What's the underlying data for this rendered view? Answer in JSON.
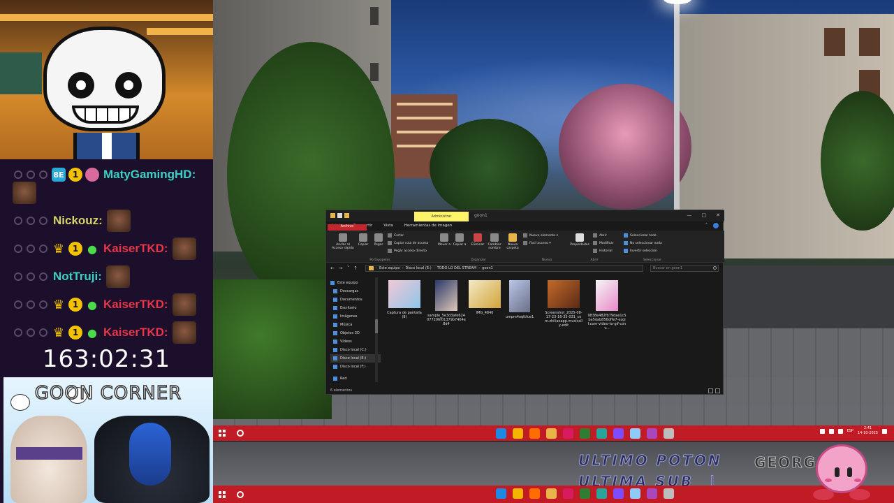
{
  "chat": {
    "messages": [
      {
        "user": "MatyGamingHD:",
        "color": "#3fd0c4",
        "badges": [
          "sq",
          "one",
          "pepe"
        ]
      },
      {
        "user": "Nickouz:",
        "color": "#d6d26a",
        "badges": []
      },
      {
        "user": "KaiserTKD:",
        "color": "#e8354a",
        "badges": [
          "crown",
          "one",
          "frog"
        ]
      },
      {
        "user": "NotTruji:",
        "color": "#3fd0c4",
        "badges": []
      },
      {
        "user": "KaiserTKD:",
        "color": "#e8354a",
        "badges": [
          "crown",
          "one",
          "frog"
        ]
      },
      {
        "user": "KaiserTKD:",
        "color": "#e8354a",
        "badges": [
          "crown",
          "one",
          "frog"
        ]
      }
    ],
    "badge_one_label": "1",
    "badge_sq_label": "8E"
  },
  "timer": "163:02:31",
  "goon_corner": {
    "title": "GOON CORNER"
  },
  "explorer": {
    "window_title": "goon1",
    "context_tab": "Administrar",
    "tabs": [
      "Archivo",
      "Inicio",
      "Compartir",
      "Vista",
      "Herramientas de imagen"
    ],
    "ribbon": {
      "pin": "Anclar al Acceso rápido",
      "copy": "Copiar",
      "paste": "Pegar",
      "cut": "Cortar",
      "copy_path": "Copiar ruta de acceso",
      "paste_shortcut": "Pegar acceso directo",
      "move_to": "Mover a",
      "copy_to": "Copiar a",
      "delete": "Eliminar",
      "rename": "Cambiar nombre",
      "new_folder": "Nueva carpeta",
      "new_item": "Nuevo elemento ▾",
      "easy_access": "Fácil acceso ▾",
      "properties": "Propiedades",
      "open": "Abrir",
      "edit": "Modificar",
      "history": "Historial",
      "select_all": "Seleccionar todo",
      "select_none": "No seleccionar nada",
      "invert_selection": "Invertir selección",
      "group_clipboard": "Portapapeles",
      "group_organize": "Organizar",
      "group_new": "Nuevo",
      "group_open": "Abrir",
      "group_select": "Seleccionar"
    },
    "address": [
      "Este equipo",
      "Disco local (E:)",
      "TODO LO DEL STREAM",
      "goon1"
    ],
    "search_placeholder": "Buscar en goon1",
    "nav_items": [
      "Este equipo",
      "Descargas",
      "Documentos",
      "Escritorio",
      "Imágenes",
      "Música",
      "Objetos 3D",
      "Vídeos",
      "Disco local (C:)",
      "Disco local (E:)",
      "Disco local (F:)",
      "Red"
    ],
    "files": [
      {
        "name": "Captura de pantalla (8)",
        "colors": [
          "#f2c8d6",
          "#8fc5ea"
        ]
      },
      {
        "name": "sample_5e3d3afe624077206f01379b7464e8d4",
        "colors": [
          "#2a3a6a",
          "#e0c8b8"
        ]
      },
      {
        "name": "IMG_4840",
        "colors": [
          "#f3e9c6",
          "#d2a43a"
        ]
      },
      {
        "name": "umpm4oqttfue1",
        "colors": [
          "#b8c7e8",
          "#6a6f86"
        ]
      },
      {
        "name": "Screenshot_2025-08-17-23-16-35-031_com.zhiliaoapp.musically-edit",
        "colors": [
          "#c46a2a",
          "#5a2a16"
        ]
      },
      {
        "name": "9838e482fb79dae1c5ba5dab856dffe7-ezgif.com-video-to-gif-conv...",
        "colors": [
          "#f5f5f5",
          "#e888c8"
        ]
      }
    ],
    "status": "6 elementos"
  },
  "taskbar": {
    "time": "2:41",
    "date": "14-10-2025",
    "lang": "ESP",
    "app_colors": [
      "#1e88e5",
      "#f4b400",
      "#ff6d00",
      "#e8b548",
      "#d81b60",
      "#2e7d32",
      "#26a69a",
      "#7c4dff",
      "#90caf9",
      "#ab47bc",
      "#bdbdbd"
    ]
  },
  "overlay": {
    "line1": "ULTIMO POTON",
    "line2": "ULTIMA SUB",
    "cursor": "_|",
    "name": "GEORG"
  }
}
